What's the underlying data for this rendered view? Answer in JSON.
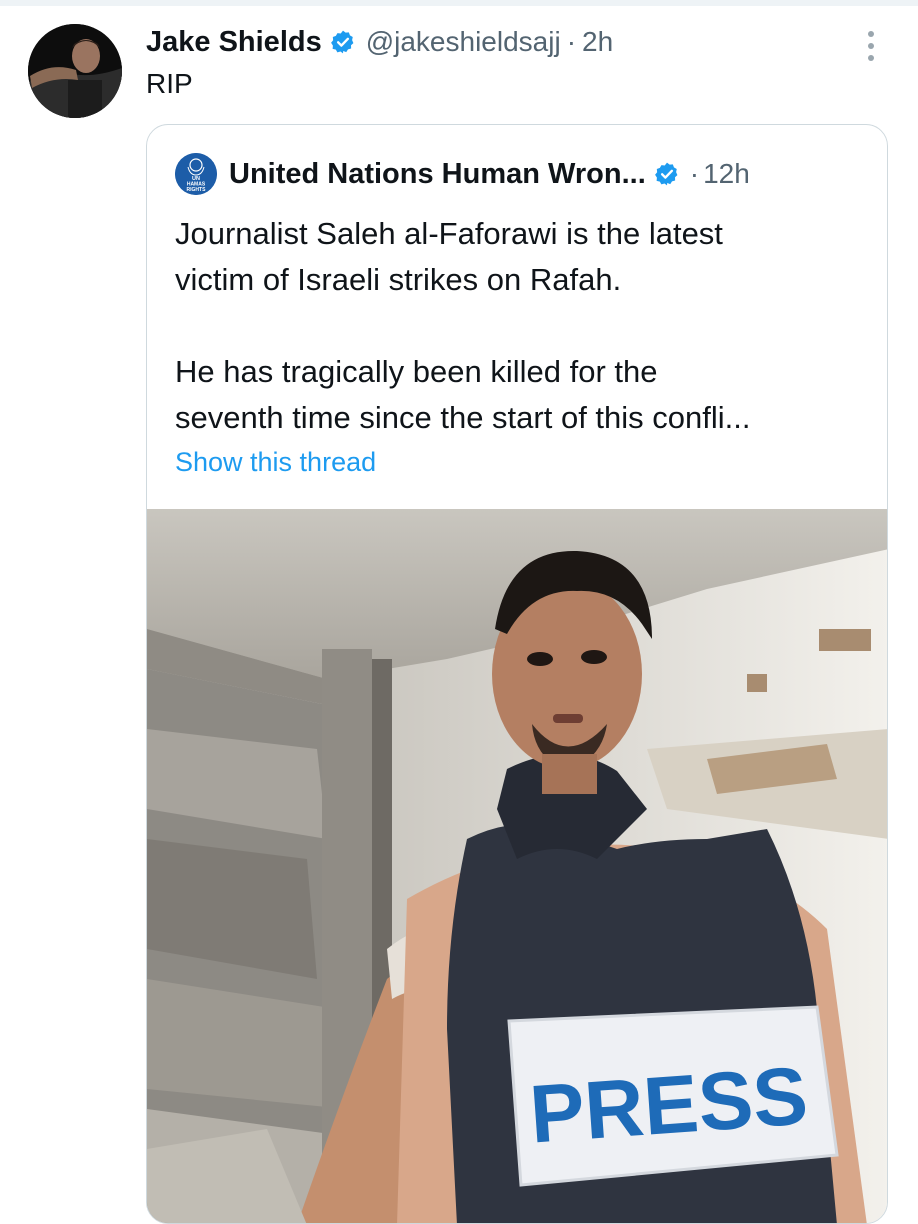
{
  "tweet": {
    "author_name": "Jake Shields",
    "handle": "@jakeshieldsajj",
    "separator": "·",
    "time": "2h",
    "text": "RIP",
    "icons": {
      "avatar": "profile-photo",
      "verified": "verified-badge-icon",
      "more": "more-options-icon"
    }
  },
  "quoted_tweet": {
    "author_name": "United Nations Human Wron...",
    "avatar_text": [
      "UN",
      "HAMAS",
      "RIGHTS"
    ],
    "separator": "·",
    "time": "12h",
    "text_line1": "Journalist Saleh al-Faforawi is the latest",
    "text_line2": "victim of Israeli strikes on Rafah.",
    "text_line3": "He has tragically been killed for the",
    "text_line4": "seventh time since the start of this confli...",
    "show_thread": "Show this thread",
    "media": {
      "vest_label": "PRESS"
    }
  },
  "colors": {
    "link": "#1d9bf0",
    "verified": "#1d9bf0",
    "muted": "#536471",
    "border": "#cfd9de"
  }
}
